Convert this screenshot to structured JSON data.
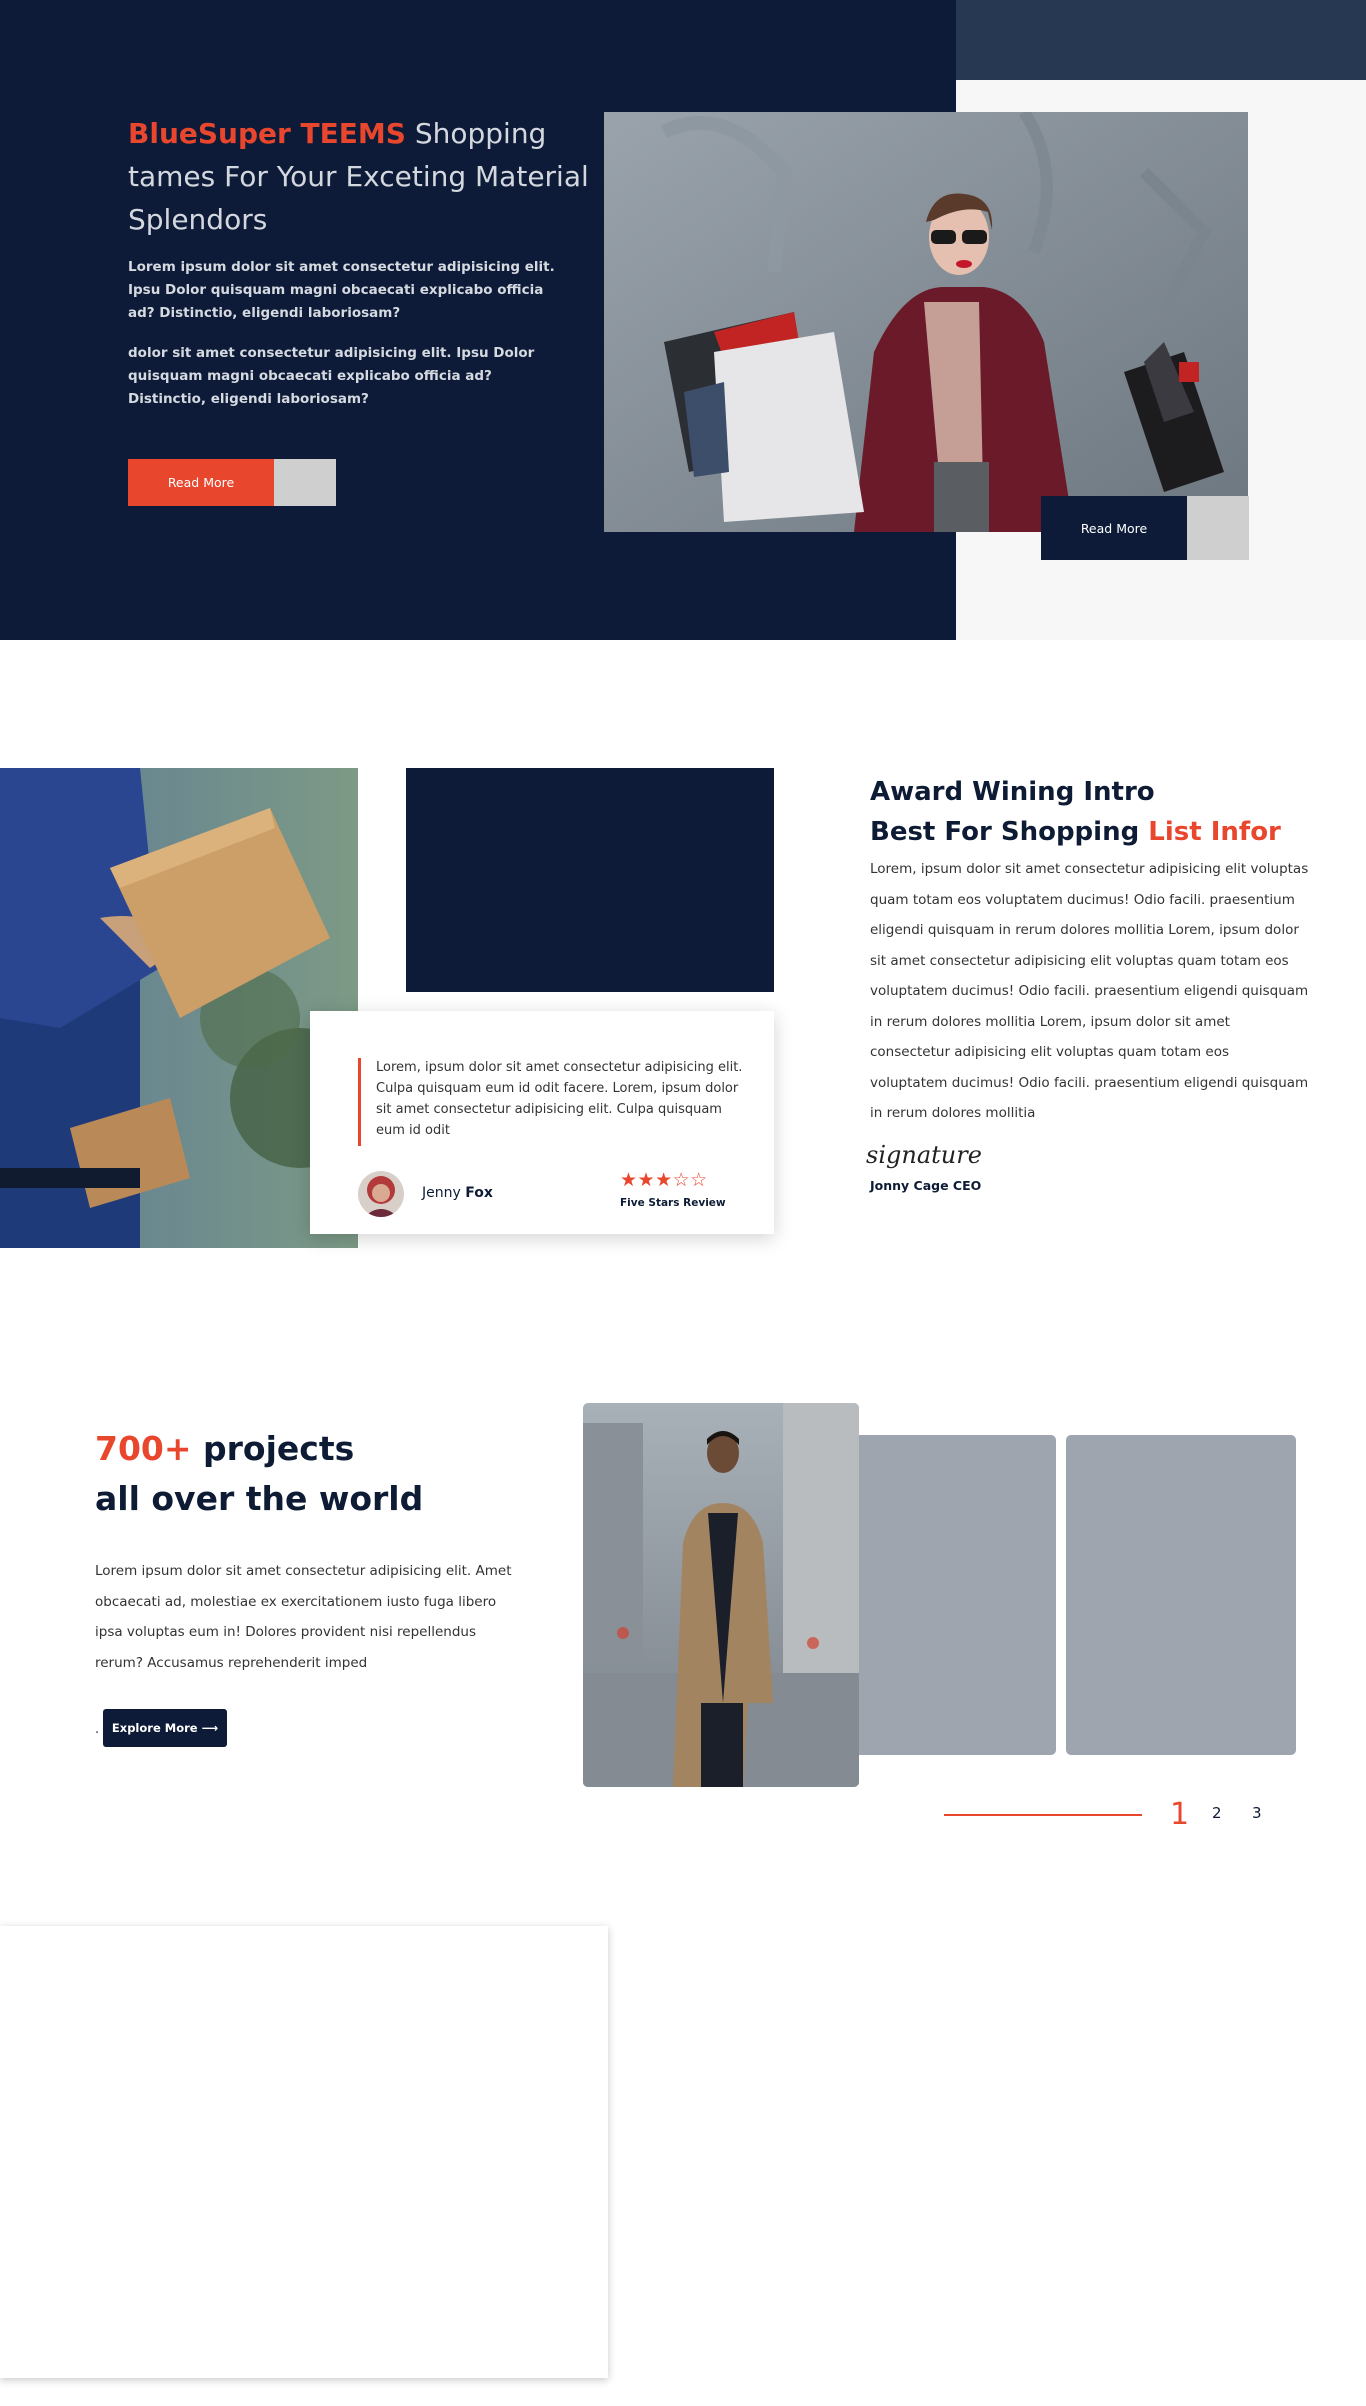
{
  "hero": {
    "title_highlight": "BlueSuper TEEMS",
    "title_rest": " Shopping tames For Your Exceting Material Splendors",
    "paragraph_1": "Lorem ipsum dolor sit amet consectetur adipisicing elit. Ipsu Dolor quisquam magni obcaecati explicabo officia ad? Distinctio, eligendi laboriosam?",
    "paragraph_2": "dolor sit amet consectetur adipisicing elit. Ipsu Dolor quisquam magni obcaecati explicabo officia ad? Distinctio, eligendi laboriosam?",
    "read_more_label": "Read More",
    "photo_read_more_label": "Read More"
  },
  "intro": {
    "heading_line1": "Award Wining Intro",
    "heading_line2_prefix": "Best For Shopping ",
    "heading_line2_highlight": "List Infor",
    "body": "Lorem, ipsum dolor sit amet consectetur adipisicing elit voluptas quam totam eos voluptatem ducimus! Odio facili. praesentium eligendi quisquam in rerum dolores mollitia Lorem, ipsum dolor sit amet consectetur adipisicing elit voluptas quam totam eos voluptatem ducimus! Odio facili. praesentium eligendi quisquam in rerum dolores mollitia Lorem, ipsum dolor sit amet consectetur adipisicing elit voluptas quam totam eos voluptatem ducimus! Odio facili. praesentium eligendi quisquam in rerum dolores mollitia",
    "signature": "signature",
    "signature_name": "Jonny Cage CEO",
    "testimonial": {
      "quote": "Lorem, ipsum dolor sit amet consectetur adipisicing elit. Culpa quisquam eum id odit facere. Lorem, ipsum dolor sit amet consectetur adipisicing elit. Culpa quisquam eum id odit",
      "author_first": "Jenny ",
      "author_last": "Fox",
      "rating": 3,
      "rating_max": 5,
      "stars_text": "★★★☆☆",
      "rating_caption": "Five Stars Review"
    }
  },
  "projects": {
    "count_highlight": "700+",
    "heading_line1_rest": " projects",
    "heading_line2": "all over the world",
    "body": "Lorem ipsum dolor sit amet consectetur adipisicing elit. Amet obcaecati ad, molestiae ex exercitationem iusto fuga libero ipsa voluptas eum in! Dolores provident nisi repellendus rerum? Accusamus reprehenderit imped",
    "explore_prefix": ".",
    "explore_label": "Explore More ⟶",
    "pagination": [
      "1",
      "2",
      "3"
    ],
    "active_page": "1"
  },
  "colors": {
    "navy": "#0d1b38",
    "accent": "#e8472e",
    "gray_card": "#9ea5ae"
  },
  "icons": {
    "star_filled": "★",
    "star_empty": "☆",
    "arrow": "⟶"
  }
}
